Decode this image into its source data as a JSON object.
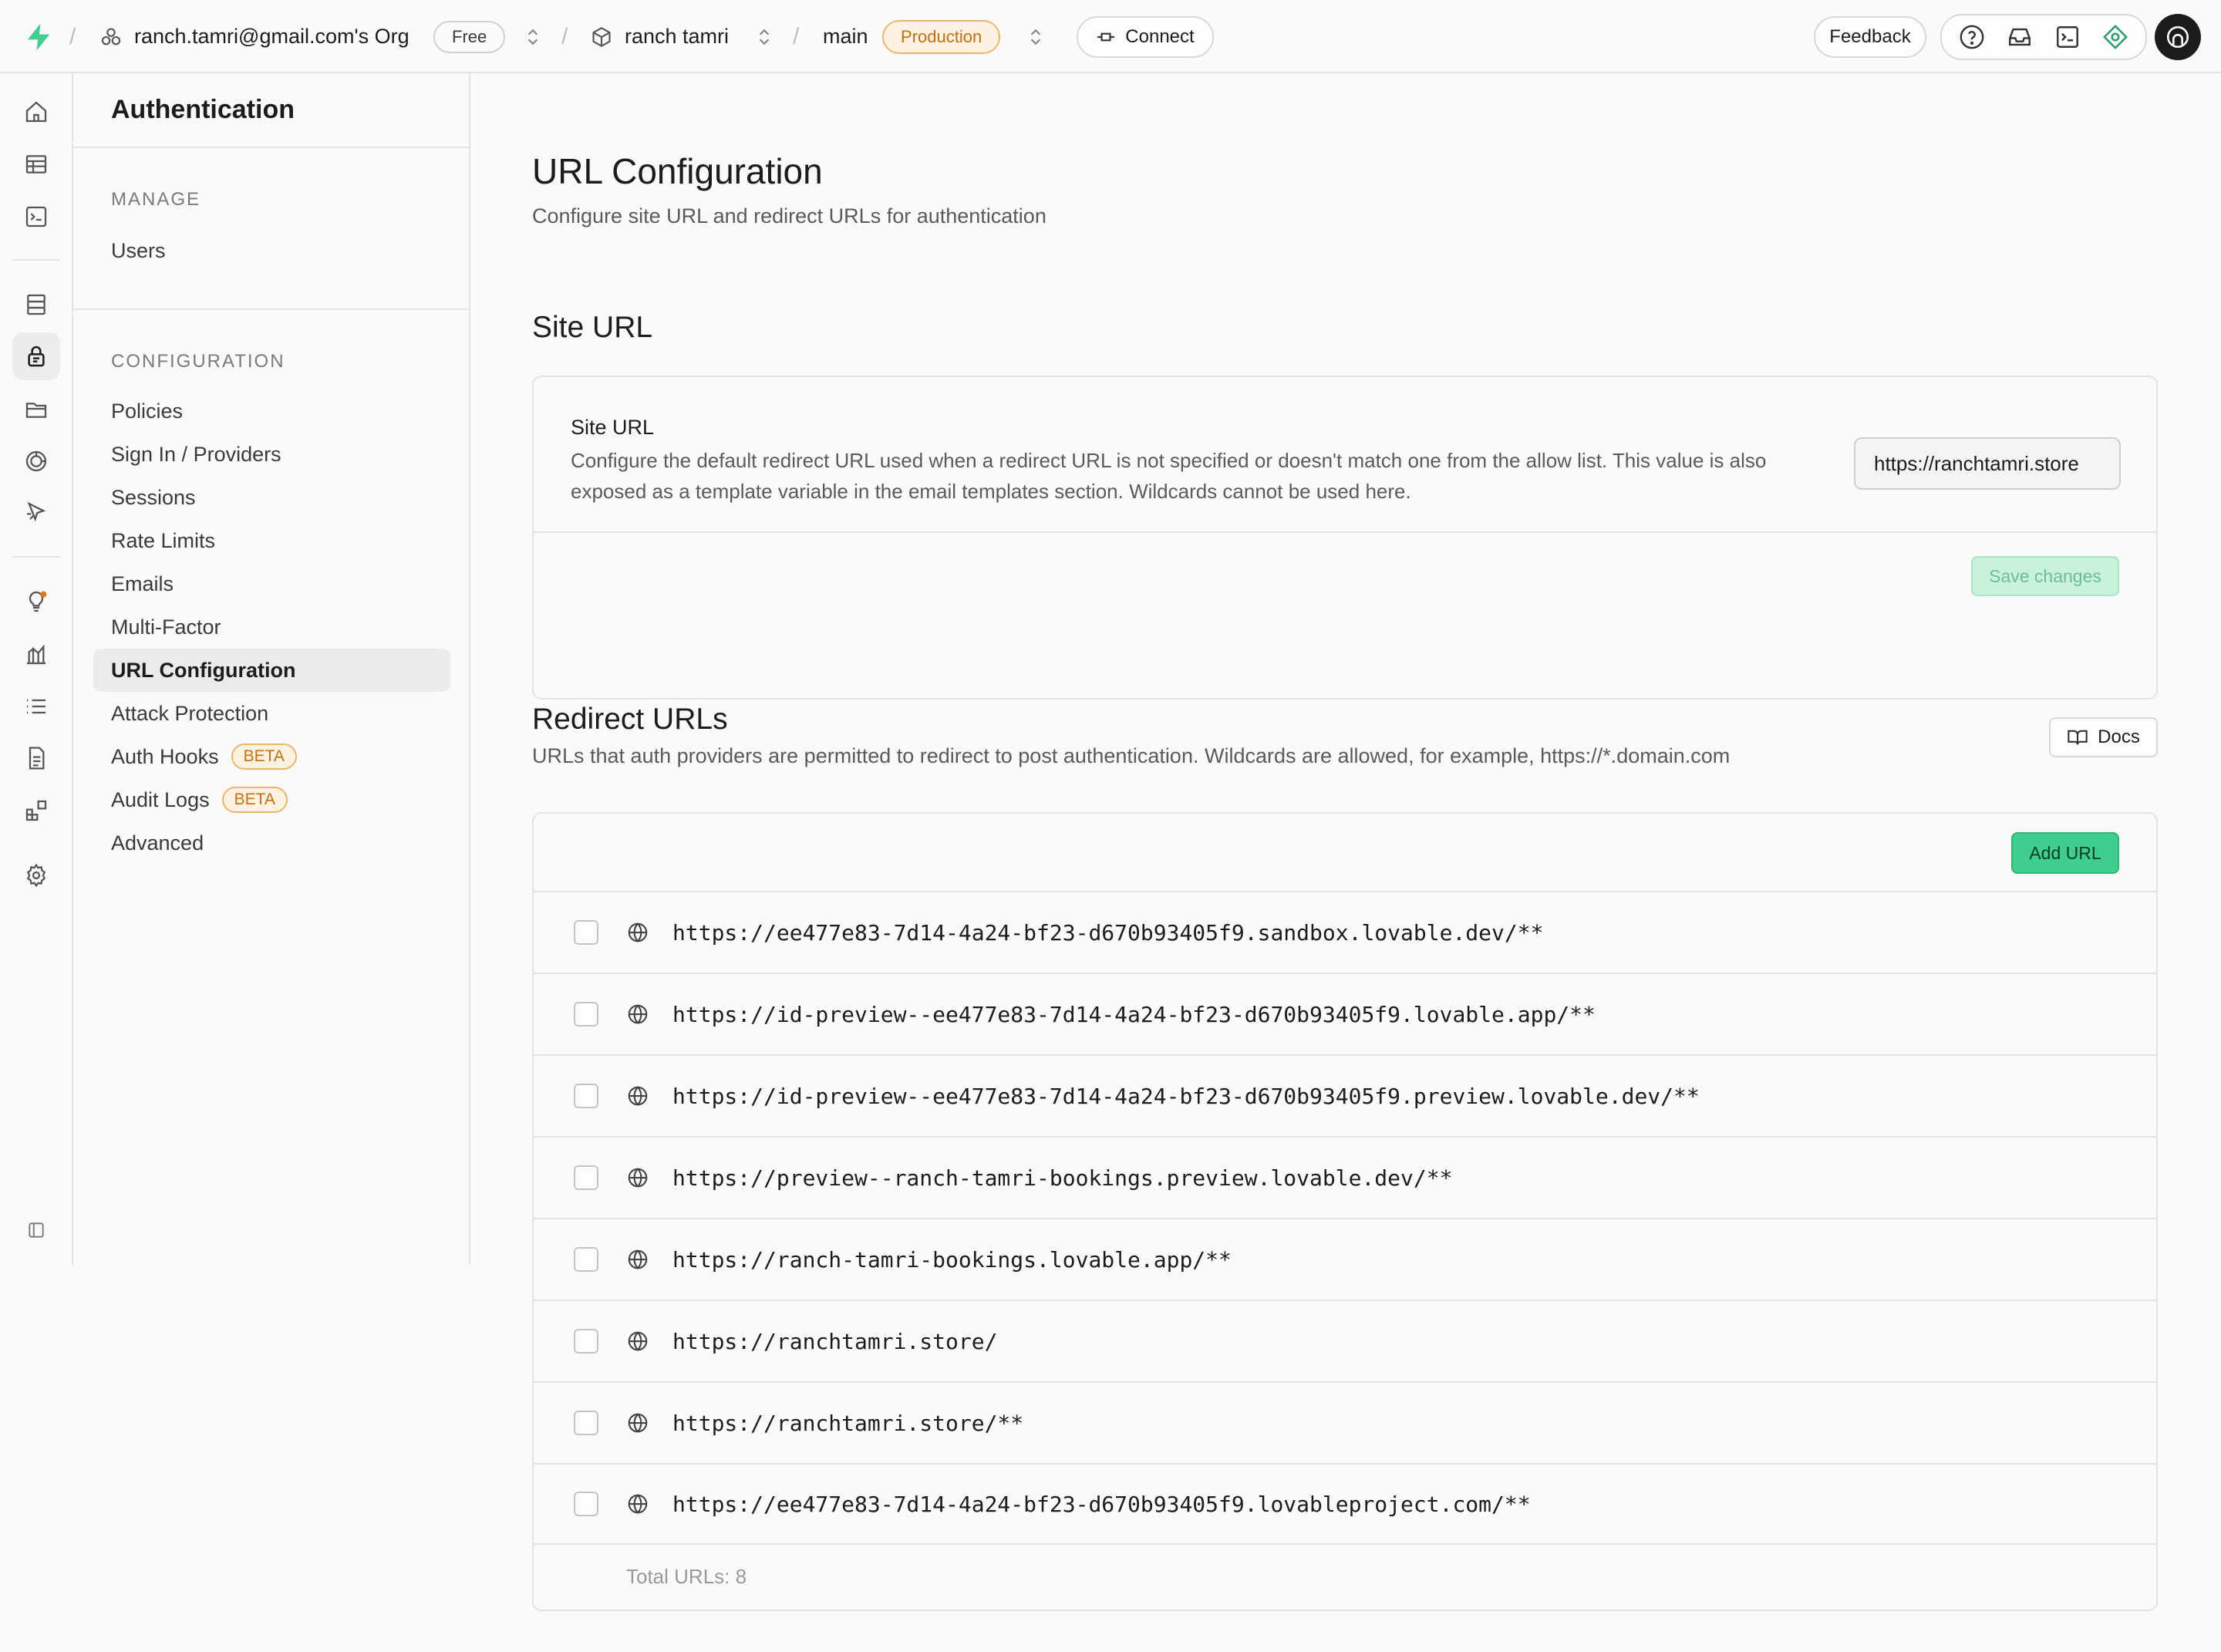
{
  "topbar": {
    "org_name": "ranch.tamri@gmail.com's Org",
    "plan_badge": "Free",
    "project_name": "ranch tamri",
    "branch_name": "main",
    "env_badge": "Production",
    "connect_label": "Connect",
    "feedback_label": "Feedback",
    "brand_color": "#3ecf8e"
  },
  "sidebar": {
    "title": "Authentication",
    "manage_label": "MANAGE",
    "manage_items": [
      {
        "label": "Users"
      }
    ],
    "config_label": "CONFIGURATION",
    "config_items": [
      {
        "label": "Policies"
      },
      {
        "label": "Sign In / Providers"
      },
      {
        "label": "Sessions"
      },
      {
        "label": "Rate Limits"
      },
      {
        "label": "Emails"
      },
      {
        "label": "Multi-Factor"
      },
      {
        "label": "URL Configuration",
        "active": true
      },
      {
        "label": "Attack Protection"
      },
      {
        "label": "Auth Hooks",
        "badge": "BETA"
      },
      {
        "label": "Audit Logs",
        "badge": "BETA"
      },
      {
        "label": "Advanced"
      }
    ]
  },
  "page": {
    "title": "URL Configuration",
    "subtitle": "Configure site URL and redirect URLs for authentication"
  },
  "site_url": {
    "section_title": "Site URL",
    "field_label": "Site URL",
    "description": "Configure the default redirect URL used when a redirect URL is not specified or doesn't match one from the allow list. This value is also exposed as a template variable in the email templates section. Wildcards cannot be used here.",
    "value": "https://ranchtamri.store",
    "save_label": "Save changes"
  },
  "redirect_urls": {
    "section_title": "Redirect URLs",
    "description": "URLs that auth providers are permitted to redirect to post authentication. Wildcards are allowed, for example, https://*.domain.com",
    "docs_label": "Docs",
    "add_label": "Add URL",
    "urls": [
      "https://ee477e83-7d14-4a24-bf23-d670b93405f9.sandbox.lovable.dev/**",
      "https://id-preview--ee477e83-7d14-4a24-bf23-d670b93405f9.lovable.app/**",
      "https://id-preview--ee477e83-7d14-4a24-bf23-d670b93405f9.preview.lovable.dev/**",
      "https://preview--ranch-tamri-bookings.preview.lovable.dev/**",
      "https://ranch-tamri-bookings.lovable.app/**",
      "https://ranchtamri.store/",
      "https://ranchtamri.store/**",
      "https://ee477e83-7d14-4a24-bf23-d670b93405f9.lovableproject.com/**"
    ],
    "total_label": "Total URLs: 8"
  }
}
